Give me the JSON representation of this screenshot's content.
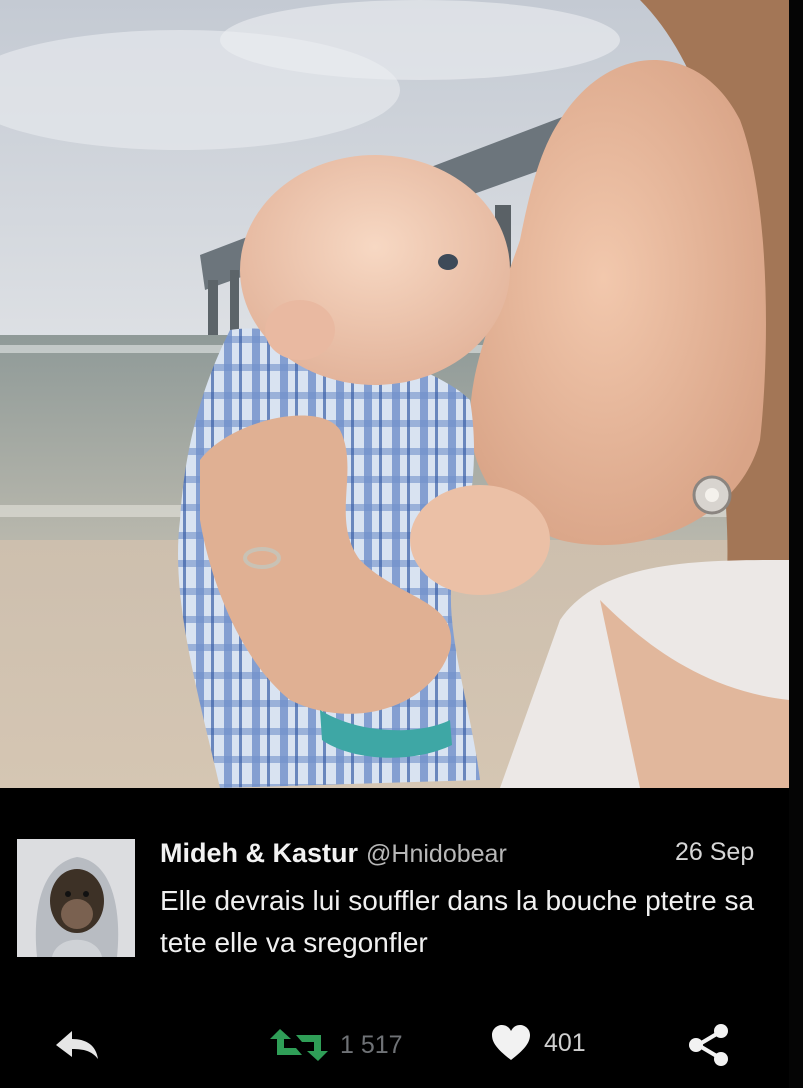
{
  "tweet": {
    "author_name": "Mideh & Kastur",
    "handle": "@Hnidobear",
    "date": "26 Sep",
    "text": "Elle devrais lui souffler dans la bouche ptetre sa tete elle va sregonfler",
    "retweet_count": "1 517",
    "like_count": "401"
  },
  "icons": {
    "reply": "reply-arrow-icon",
    "retweet": "retweet-icon",
    "like": "heart-icon",
    "share": "share-icon"
  },
  "colors": {
    "background": "#000000",
    "retweet_green": "#2f9e57",
    "text": "#f0f0f0"
  }
}
